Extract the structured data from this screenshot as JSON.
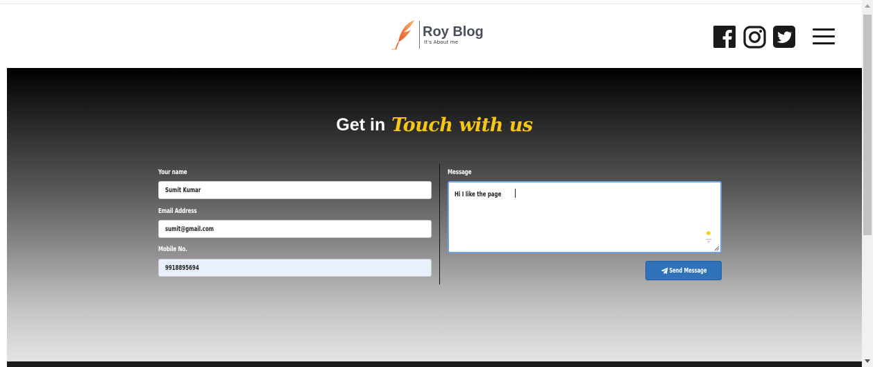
{
  "header": {
    "logo_title": "Roy Blog",
    "logo_tagline": "It's About me",
    "social_icons": [
      "facebook-icon",
      "instagram-icon",
      "twitter-icon"
    ],
    "menu_icon": "hamburger-menu-icon"
  },
  "contact": {
    "heading_prefix": "Get in",
    "heading_accent": "Touch with us",
    "name_label": "Your name",
    "name_value": "Sumit Kumar",
    "email_label": "Email Address",
    "email_value": "sumit@gmail.com",
    "mobile_label": "Mobile No.",
    "mobile_value": "9918895694",
    "message_label": "Message",
    "message_value": "Hi I  like the page",
    "send_label": "Send Message"
  },
  "colors": {
    "accent_yellow": "#f5c518",
    "logo_orange": "#f08a3c",
    "button_blue": "#2f72b9",
    "autofill_blue": "#e8f0fe",
    "icon_dark": "#1a1a1a"
  }
}
